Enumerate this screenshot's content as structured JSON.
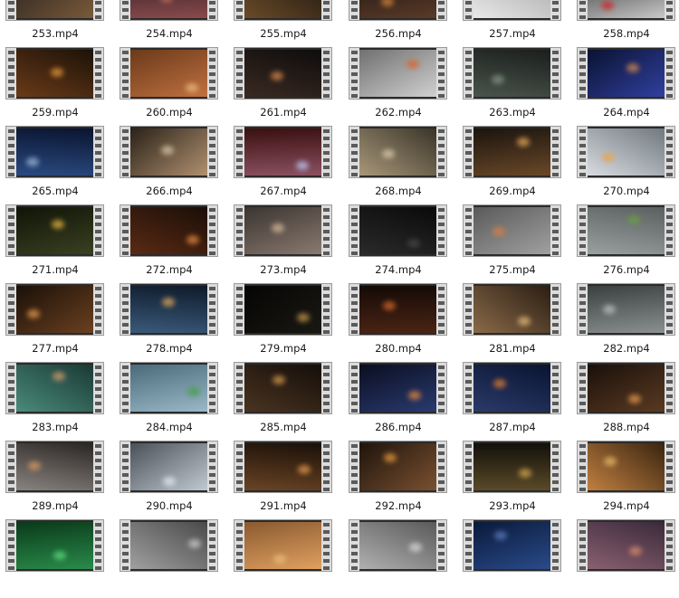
{
  "files": [
    {
      "name": "253.mp4",
      "colors": [
        "#2a2420",
        "#7a5a3a"
      ],
      "accent": "#c89050"
    },
    {
      "name": "254.mp4",
      "colors": [
        "#281c28",
        "#8a4a4a"
      ],
      "accent": "#d07060"
    },
    {
      "name": "255.mp4",
      "colors": [
        "#1e1810",
        "#6a4a28"
      ],
      "accent": "#e0a050"
    },
    {
      "name": "256.mp4",
      "colors": [
        "#1a1412",
        "#5a3a28"
      ],
      "accent": "#e08a40"
    },
    {
      "name": "257.mp4",
      "colors": [
        "#a8a8a8",
        "#e8e8e8"
      ],
      "accent": "#ffffff"
    },
    {
      "name": "258.mp4",
      "colors": [
        "#3a3a3a",
        "#c8c8c8"
      ],
      "accent": "#d02020"
    },
    {
      "name": "259.mp4",
      "colors": [
        "#1c1208",
        "#6a3a18"
      ],
      "accent": "#f0a040"
    },
    {
      "name": "260.mp4",
      "colors": [
        "#6a3a1a",
        "#c07040"
      ],
      "accent": "#f0c080"
    },
    {
      "name": "261.mp4",
      "colors": [
        "#0e0c0c",
        "#3a2a22"
      ],
      "accent": "#e09050"
    },
    {
      "name": "262.mp4",
      "colors": [
        "#707070",
        "#d0d0d0"
      ],
      "accent": "#e06020"
    },
    {
      "name": "263.mp4",
      "colors": [
        "#1a1e1c",
        "#4a544c"
      ],
      "accent": "#8a9a8a"
    },
    {
      "name": "264.mp4",
      "colors": [
        "#0a1230",
        "#3040a0"
      ],
      "accent": "#e09050"
    },
    {
      "name": "265.mp4",
      "colors": [
        "#0a1430",
        "#2a4a80"
      ],
      "accent": "#a0c0e0"
    },
    {
      "name": "266.mp4",
      "colors": [
        "#2a2218",
        "#b09070"
      ],
      "accent": "#e0d0b0"
    },
    {
      "name": "267.mp4",
      "colors": [
        "#3a1010",
        "#8a5060"
      ],
      "accent": "#c0d0ff"
    },
    {
      "name": "268.mp4",
      "colors": [
        "#3a3428",
        "#a8987a"
      ],
      "accent": "#e0d0b0"
    },
    {
      "name": "269.mp4",
      "colors": [
        "#1a140e",
        "#6a4828"
      ],
      "accent": "#f0b060"
    },
    {
      "name": "270.mp4",
      "colors": [
        "#707880",
        "#d8dce0"
      ],
      "accent": "#f0a040"
    },
    {
      "name": "271.mp4",
      "colors": [
        "#101408",
        "#3a4020"
      ],
      "accent": "#f0c040"
    },
    {
      "name": "272.mp4",
      "colors": [
        "#1a0e08",
        "#5a2a14"
      ],
      "accent": "#f09040"
    },
    {
      "name": "273.mp4",
      "colors": [
        "#3a3430",
        "#8a7a70"
      ],
      "accent": "#e0c0a0"
    },
    {
      "name": "274.mp4",
      "colors": [
        "#0a0a0a",
        "#2a2a2a"
      ],
      "accent": "#4a4a4a"
    },
    {
      "name": "275.mp4",
      "colors": [
        "#5a5a5a",
        "#a0a0a0"
      ],
      "accent": "#e08040"
    },
    {
      "name": "276.mp4",
      "colors": [
        "#5a6060",
        "#9aa0a0"
      ],
      "accent": "#6aa040"
    },
    {
      "name": "277.mp4",
      "colors": [
        "#1a1008",
        "#6a4020"
      ],
      "accent": "#f0a050"
    },
    {
      "name": "278.mp4",
      "colors": [
        "#0e1a2a",
        "#3a5a7a"
      ],
      "accent": "#f0b060"
    },
    {
      "name": "279.mp4",
      "colors": [
        "#050505",
        "#1a1812"
      ],
      "accent": "#d0a050"
    },
    {
      "name": "280.mp4",
      "colors": [
        "#140a06",
        "#4a2414"
      ],
      "accent": "#e07030"
    },
    {
      "name": "281.mp4",
      "colors": [
        "#2a1e14",
        "#8a6a48"
      ],
      "accent": "#f0c080"
    },
    {
      "name": "282.mp4",
      "colors": [
        "#3a4040",
        "#8a9090"
      ],
      "accent": "#c0c8c8"
    },
    {
      "name": "283.mp4",
      "colors": [
        "#1a3a34",
        "#4a8a7a"
      ],
      "accent": "#e0a070"
    },
    {
      "name": "284.mp4",
      "colors": [
        "#4a6a7a",
        "#9ab8c8"
      ],
      "accent": "#40a040"
    },
    {
      "name": "285.mp4",
      "colors": [
        "#140e0a",
        "#4a3420"
      ],
      "accent": "#e0a050"
    },
    {
      "name": "286.mp4",
      "colors": [
        "#0a0e20",
        "#2a3a70"
      ],
      "accent": "#f09040"
    },
    {
      "name": "287.mp4",
      "colors": [
        "#0a1430",
        "#2a3a6a"
      ],
      "accent": "#f08030"
    },
    {
      "name": "288.mp4",
      "colors": [
        "#1a100a",
        "#5a3a22"
      ],
      "accent": "#f0a050"
    },
    {
      "name": "289.mp4",
      "colors": [
        "#2a2624",
        "#8a8480"
      ],
      "accent": "#e0a060"
    },
    {
      "name": "290.mp4",
      "colors": [
        "#4a5058",
        "#c0c8d0"
      ],
      "accent": "#e8f0f8"
    },
    {
      "name": "291.mp4",
      "colors": [
        "#1a1008",
        "#6a4424"
      ],
      "accent": "#f0a050"
    },
    {
      "name": "292.mp4",
      "colors": [
        "#1e140c",
        "#7a5030"
      ],
      "accent": "#f0a040"
    },
    {
      "name": "293.mp4",
      "colors": [
        "#12100a",
        "#5a4a28"
      ],
      "accent": "#e0b050"
    },
    {
      "name": "294.mp4",
      "colors": [
        "#3a2410",
        "#c08040"
      ],
      "accent": "#f0c070"
    },
    {
      "name": "",
      "colors": [
        "#0a3a1a",
        "#2a8a4a"
      ],
      "accent": "#60e080"
    },
    {
      "name": "",
      "colors": [
        "#4a4a4a",
        "#a0a0a0"
      ],
      "accent": "#d0d0d0"
    },
    {
      "name": "",
      "colors": [
        "#8a5a30",
        "#e0a060"
      ],
      "accent": "#f0c080"
    },
    {
      "name": "",
      "colors": [
        "#5a5a5a",
        "#b0b0b0"
      ],
      "accent": "#e0e0e0"
    },
    {
      "name": "",
      "colors": [
        "#0a1a3a",
        "#2a4a8a"
      ],
      "accent": "#6080c0"
    },
    {
      "name": "",
      "colors": [
        "#3a2a3a",
        "#8a6070"
      ],
      "accent": "#e09070"
    }
  ]
}
